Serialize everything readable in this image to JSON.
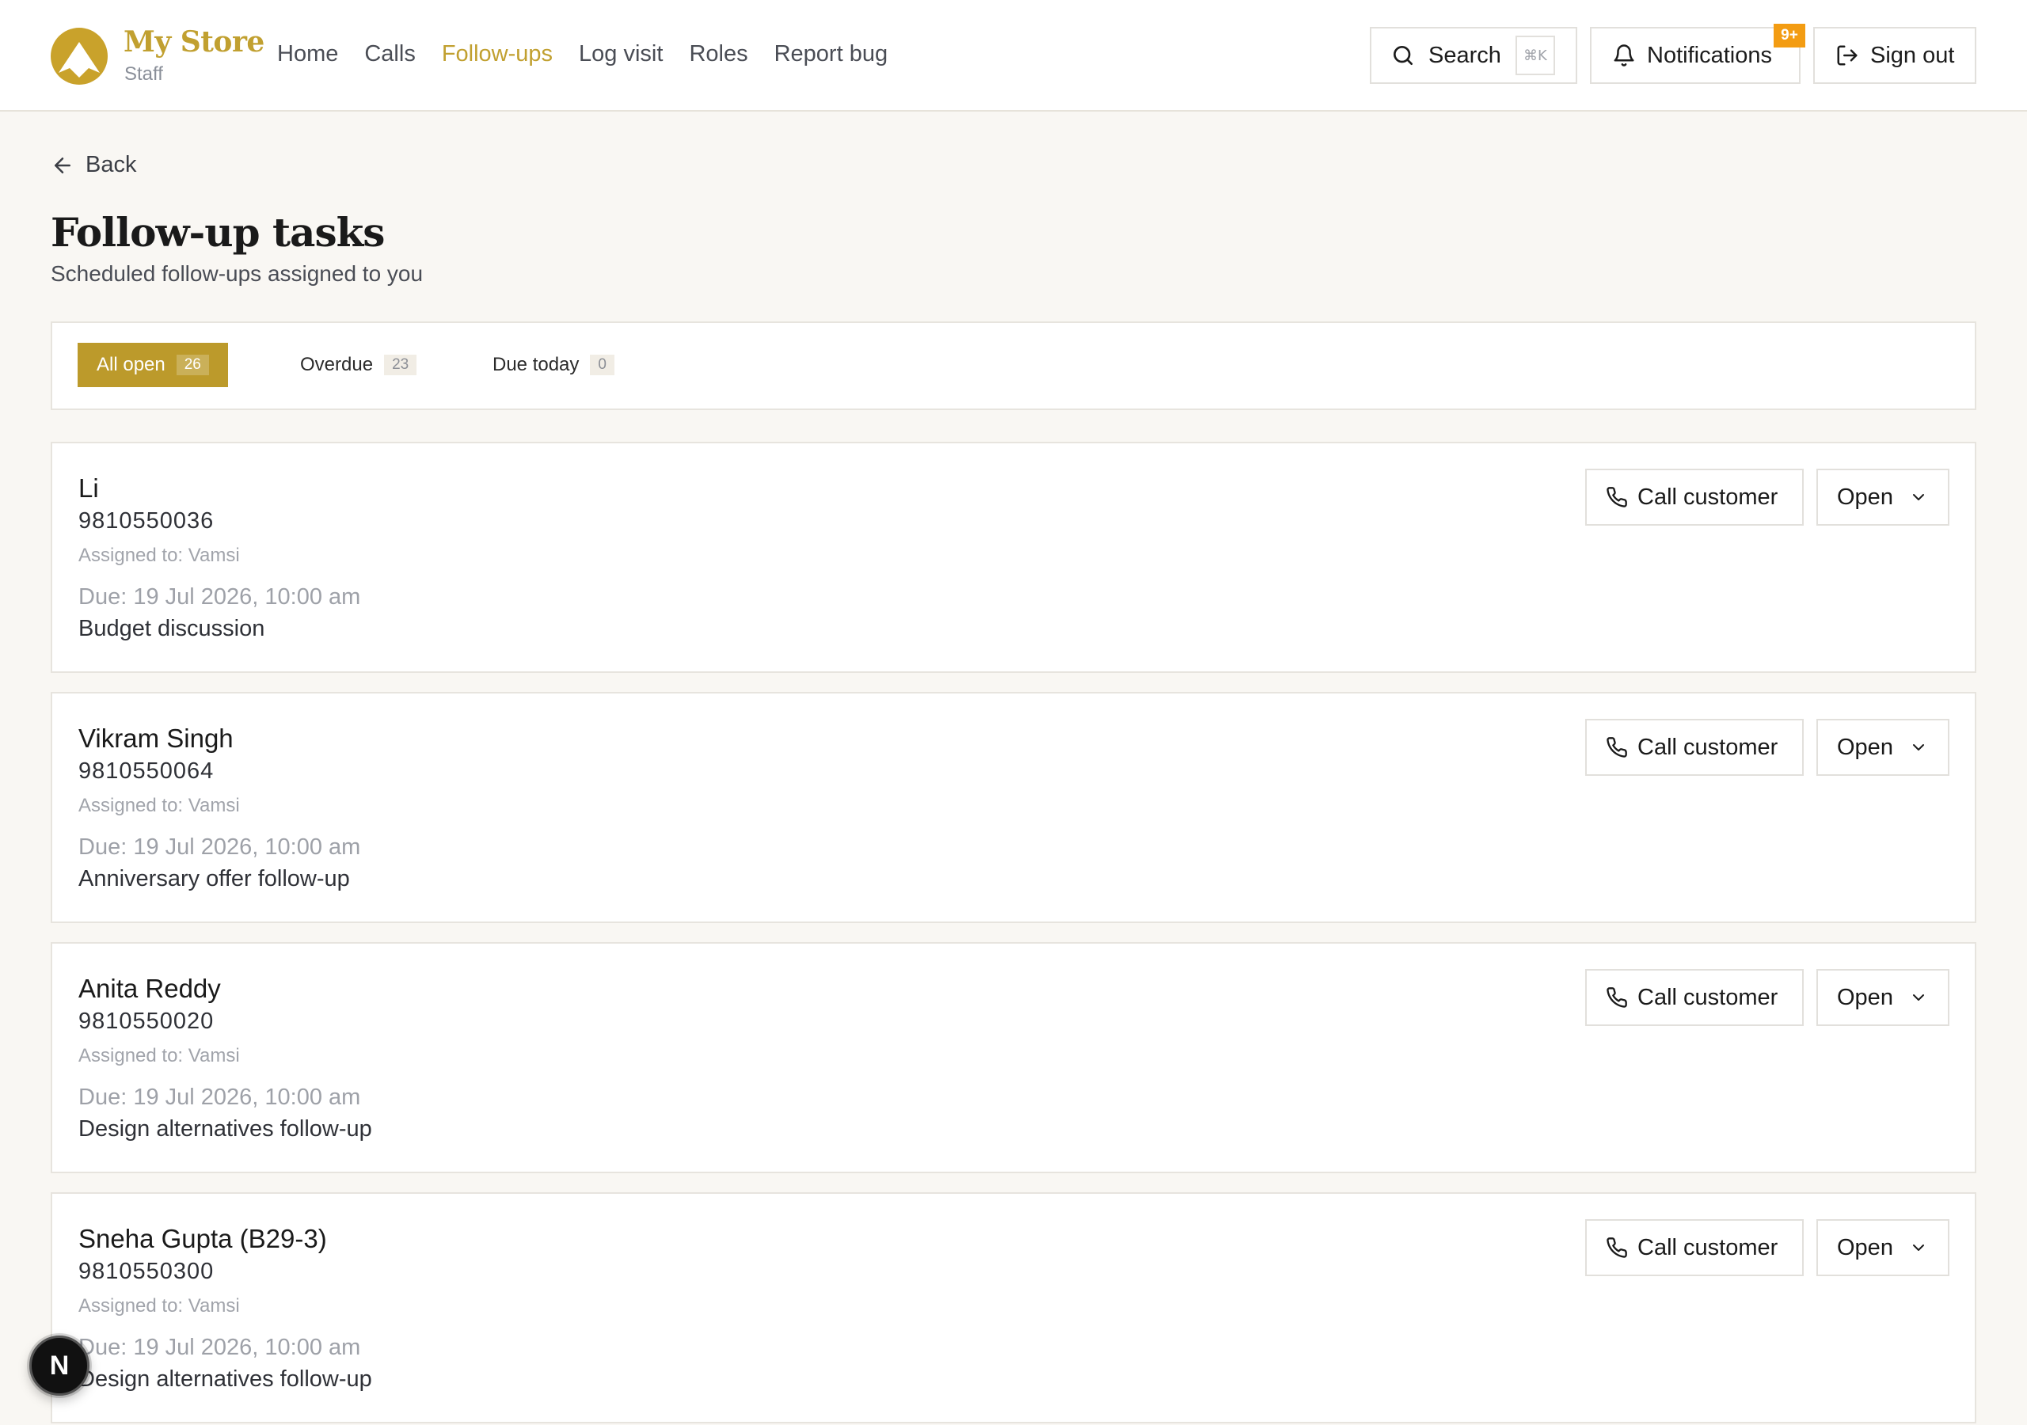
{
  "brand": {
    "name": "My Store",
    "role": "Staff",
    "accent_color": "#c1a030"
  },
  "nav": {
    "items": [
      {
        "label": "Home"
      },
      {
        "label": "Calls"
      },
      {
        "label": "Follow-ups",
        "active": true
      },
      {
        "label": "Log visit"
      },
      {
        "label": "Roles"
      },
      {
        "label": "Report bug"
      }
    ]
  },
  "header": {
    "search_label": "Search",
    "search_shortcut": "⌘K",
    "notifications_label": "Notifications",
    "notifications_badge": "9+",
    "signout_label": "Sign out"
  },
  "page": {
    "back_label": "Back",
    "title": "Follow-up tasks",
    "subtitle": "Scheduled follow-ups assigned to you"
  },
  "filters": [
    {
      "label": "All open",
      "count": "26",
      "active": true
    },
    {
      "label": "Overdue",
      "count": "23"
    },
    {
      "label": "Due today",
      "count": "0"
    }
  ],
  "tasks": [
    {
      "name": "Li",
      "phone": "9810550036",
      "assigned": "Assigned to: Vamsi",
      "due": "Due: 19 Jul 2026, 10:00 am",
      "note": "Budget discussion",
      "call_label": "Call customer",
      "open_label": "Open"
    },
    {
      "name": "Vikram Singh",
      "phone": "9810550064",
      "assigned": "Assigned to: Vamsi",
      "due": "Due: 19 Jul 2026, 10:00 am",
      "note": "Anniversary offer follow-up",
      "call_label": "Call customer",
      "open_label": "Open"
    },
    {
      "name": "Anita Reddy",
      "phone": "9810550020",
      "assigned": "Assigned to: Vamsi",
      "due": "Due: 19 Jul 2026, 10:00 am",
      "note": "Design alternatives follow-up",
      "call_label": "Call customer",
      "open_label": "Open"
    },
    {
      "name": "Sneha Gupta (B29-3)",
      "phone": "9810550300",
      "assigned": "Assigned to: Vamsi",
      "due": "Due: 19 Jul 2026, 10:00 am",
      "note": "Design alternatives follow-up",
      "call_label": "Call customer",
      "open_label": "Open"
    }
  ],
  "dev_badge": "N"
}
